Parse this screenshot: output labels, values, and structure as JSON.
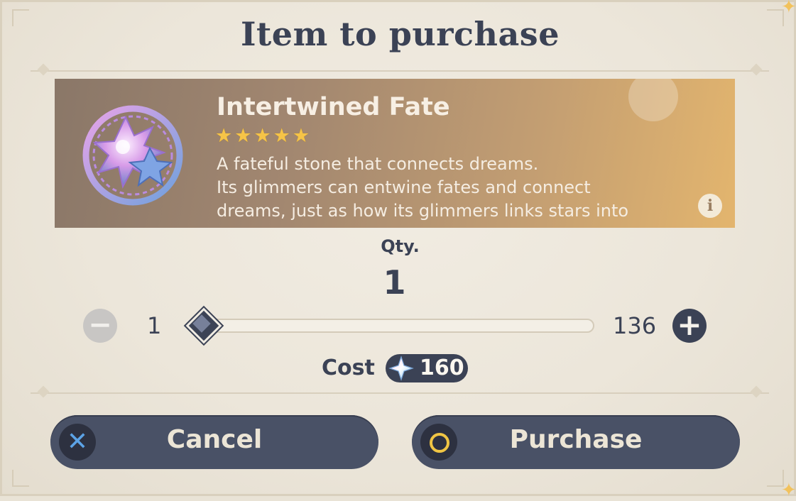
{
  "dialog": {
    "title": "Item to purchase"
  },
  "item": {
    "name": "Intertwined Fate",
    "rarity_stars": 5,
    "star_glyph": "★",
    "description_lines": [
      "A fateful stone that connects dreams.",
      "Its glimmers can entwine fates and connect",
      "dreams, just as how its glimmers links stars into"
    ],
    "info_icon": "info-icon",
    "info_glyph": "i"
  },
  "quantity": {
    "label": "Qty.",
    "value": "1",
    "min": "1",
    "max": "136",
    "slider_fraction": 0.0,
    "minus_glyph": "−",
    "plus_glyph": "+"
  },
  "cost": {
    "label": "Cost",
    "value": "160",
    "currency_icon": "primogem-icon"
  },
  "buttons": {
    "cancel_label": "Cancel",
    "purchase_label": "Purchase",
    "cancel_glyph": "✕"
  },
  "colors": {
    "text_dark": "#3b4255",
    "button_bg": "#495166",
    "star_gold": "#f6c447",
    "cancel_icon_blue": "#5ca3e6",
    "purchase_icon_gold": "#f0c544"
  }
}
